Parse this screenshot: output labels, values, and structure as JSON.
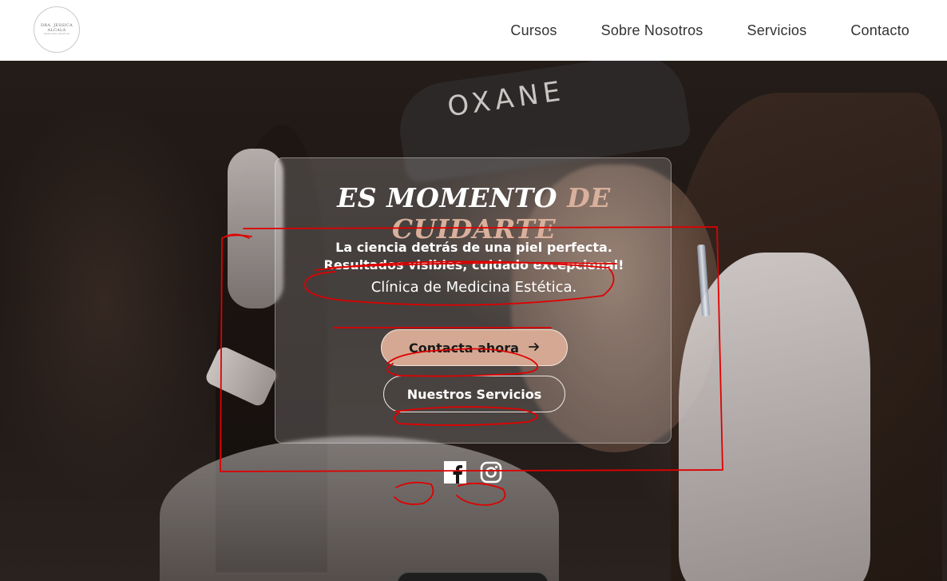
{
  "header": {
    "logo": {
      "line1": "DRA. JESSICA ALCALA",
      "line2": "medicina estetica"
    },
    "nav": [
      {
        "label": "Cursos"
      },
      {
        "label": "Sobre Nosotros"
      },
      {
        "label": "Servicios"
      },
      {
        "label": "Contacto"
      }
    ]
  },
  "hero": {
    "background_text": "OXANE",
    "headline_part1": "ES MOMENTO",
    "headline_part2": "DE CUIDARTE",
    "line1": "La ciencia detrás de una piel perfecta.",
    "line2": "Resultados visibles, cuidado excepcional!",
    "line3": "Clínica de Medicina Estética.",
    "primary_button": "Contacta ahora",
    "primary_button_icon": "arrow-right-icon",
    "secondary_button": "Nuestros Servicios"
  },
  "socials": [
    {
      "name": "facebook-icon"
    },
    {
      "name": "instagram-icon"
    }
  ],
  "colors": {
    "accent": "#d4a892",
    "headline_accent": "#d9b09c",
    "annotation": "#e00000"
  }
}
